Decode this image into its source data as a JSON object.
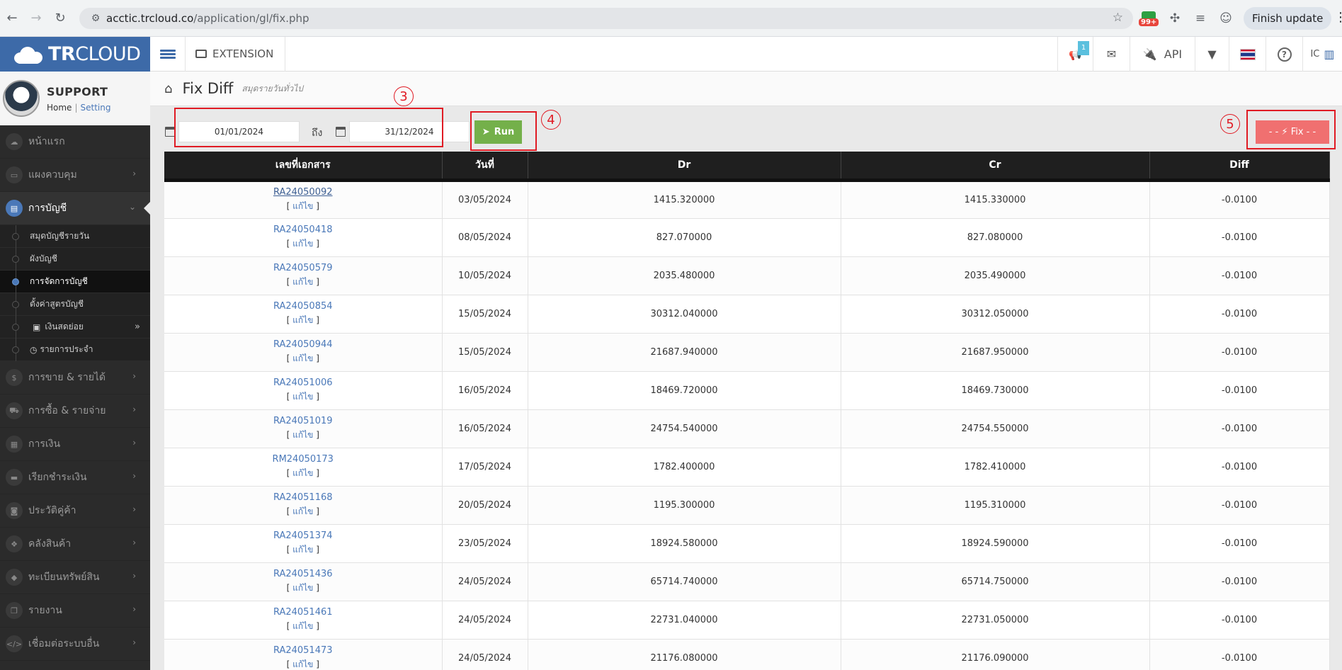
{
  "browser": {
    "url_host": "acctic.trcloud.co",
    "url_path": "/application/gl/fix.php",
    "ext_badge": "99+",
    "finish_update": "Finish update"
  },
  "sidebar": {
    "logo_bold": "TR",
    "logo_light": "CLOUD",
    "user_name": "SUPPORT",
    "home_link": "Home",
    "setting_link": "Setting",
    "menu_top": [
      {
        "label": "หน้าแรก",
        "icon": "cloud-icon"
      },
      {
        "label": "แผงควบคุม",
        "icon": "monitor-icon"
      },
      {
        "label": "การบัญชี",
        "icon": "book-icon"
      }
    ],
    "sub_items": [
      {
        "label": "สมุดบัญชีรายวัน"
      },
      {
        "label": "ผังบัญชี"
      },
      {
        "label": "การจัดการบัญชี"
      },
      {
        "label": "ตั้งค่าสูตรบัญชี"
      },
      {
        "label": "เงินสดย่อย"
      },
      {
        "label": "รายการประจำ"
      }
    ],
    "menu_bottom": [
      {
        "label": "การขาย & รายได้",
        "icon": "dollar-icon"
      },
      {
        "label": "การซื้อ & รายจ่าย",
        "icon": "cart-icon"
      },
      {
        "label": "การเงิน",
        "icon": "calendar-icon"
      },
      {
        "label": "เรียกชำระเงิน",
        "icon": "card-icon"
      },
      {
        "label": "ประวัติคู่ค้า",
        "icon": "contact-icon"
      },
      {
        "label": "คลังสินค้า",
        "icon": "cubes-icon"
      },
      {
        "label": "ทะเบียนทรัพย์สิน",
        "icon": "diamond-icon"
      },
      {
        "label": "รายงาน",
        "icon": "copy-icon"
      },
      {
        "label": "เชื่อมต่อระบบอื่น",
        "icon": "code-icon"
      }
    ]
  },
  "navbar": {
    "extension": "EXTENSION",
    "notif_count": "1",
    "api": "API",
    "ic": "IC"
  },
  "page": {
    "title": "Fix Diff",
    "subtitle": "สมุดรายวันทั่วไป"
  },
  "filters": {
    "date_from": "01/01/2024",
    "to_label": "ถึง",
    "date_to": "31/12/2024",
    "run_label": "Run",
    "fix_label": "- - ⚡ Fix - -"
  },
  "annotations": [
    "3",
    "4",
    "5"
  ],
  "table": {
    "headers": [
      "เลขที่เอกสาร",
      "วันที่",
      "Dr",
      "Cr",
      "Diff"
    ],
    "edit_label": "แก้ไข",
    "rows": [
      {
        "doc": "RA24050092",
        "date": "03/05/2024",
        "dr": "1415.320000",
        "cr": "1415.330000",
        "diff": "-0.0100"
      },
      {
        "doc": "RA24050418",
        "date": "08/05/2024",
        "dr": "827.070000",
        "cr": "827.080000",
        "diff": "-0.0100"
      },
      {
        "doc": "RA24050579",
        "date": "10/05/2024",
        "dr": "2035.480000",
        "cr": "2035.490000",
        "diff": "-0.0100"
      },
      {
        "doc": "RA24050854",
        "date": "15/05/2024",
        "dr": "30312.040000",
        "cr": "30312.050000",
        "diff": "-0.0100"
      },
      {
        "doc": "RA24050944",
        "date": "15/05/2024",
        "dr": "21687.940000",
        "cr": "21687.950000",
        "diff": "-0.0100"
      },
      {
        "doc": "RA24051006",
        "date": "16/05/2024",
        "dr": "18469.720000",
        "cr": "18469.730000",
        "diff": "-0.0100"
      },
      {
        "doc": "RA24051019",
        "date": "16/05/2024",
        "dr": "24754.540000",
        "cr": "24754.550000",
        "diff": "-0.0100"
      },
      {
        "doc": "RM24050173",
        "date": "17/05/2024",
        "dr": "1782.400000",
        "cr": "1782.410000",
        "diff": "-0.0100"
      },
      {
        "doc": "RA24051168",
        "date": "20/05/2024",
        "dr": "1195.300000",
        "cr": "1195.310000",
        "diff": "-0.0100"
      },
      {
        "doc": "RA24051374",
        "date": "23/05/2024",
        "dr": "18924.580000",
        "cr": "18924.590000",
        "diff": "-0.0100"
      },
      {
        "doc": "RA24051436",
        "date": "24/05/2024",
        "dr": "65714.740000",
        "cr": "65714.750000",
        "diff": "-0.0100"
      },
      {
        "doc": "RA24051461",
        "date": "24/05/2024",
        "dr": "22731.040000",
        "cr": "22731.050000",
        "diff": "-0.0100"
      },
      {
        "doc": "RA24051473",
        "date": "24/05/2024",
        "dr": "21176.080000",
        "cr": "21176.090000",
        "diff": "-0.0100"
      }
    ]
  }
}
